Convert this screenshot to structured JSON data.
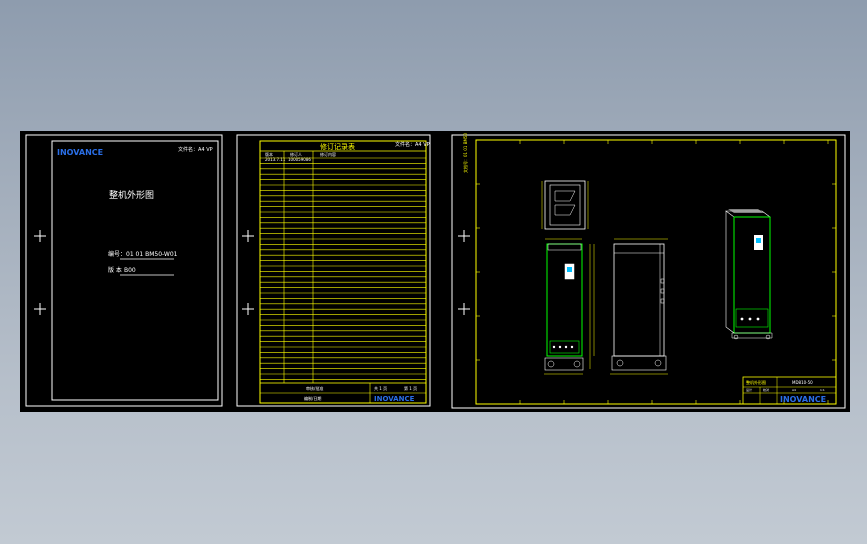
{
  "cover": {
    "logo": "INOVANCE",
    "ref": "文件名：A4 VP",
    "title": "整机外形图",
    "number_label": "编号",
    "number_value": "：01 01 BM50-W01",
    "version_label": "版 本",
    "version_value": "B00"
  },
  "revision": {
    "title": "修订记录表",
    "ref": "文件名：A4 VP",
    "headers": [
      "版本",
      "修订人",
      "修订内容"
    ],
    "first_row": [
      "2013.7.11",
      "100059086",
      ""
    ],
    "footer_left_top": "审核/批准",
    "footer_left_bottom": "编制/日期",
    "footer_page": "共 1 页",
    "footer_page2": "第 1 页",
    "logo": "INOVANCE"
  },
  "drawing": {
    "side_text": "文档号：01 01 BM50",
    "tb_title": "整机外形图",
    "tb_model": "MD810-50",
    "tb_small1": "设计",
    "tb_small2": "校对",
    "tb_small3": "A4",
    "tb_small4": "1:1",
    "logo": "INOVANCE"
  },
  "colors": {
    "background": "#000000",
    "frame": "#ffffff",
    "cad_yellow": "#ffff00",
    "cad_green": "#00ff00",
    "cad_cyan": "#00bfff"
  }
}
